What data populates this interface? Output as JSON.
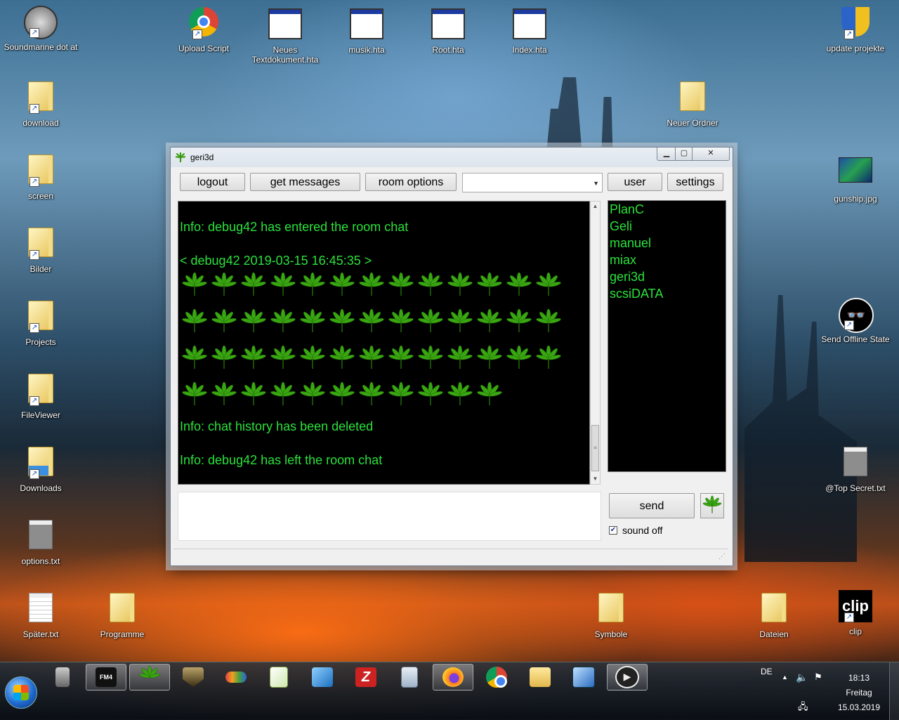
{
  "desktop": {
    "icons": [
      {
        "label": "Soundmarine dot at"
      },
      {
        "label": "Upload Script"
      },
      {
        "label": "Neues Textdokument.hta"
      },
      {
        "label": "musik.hta"
      },
      {
        "label": "Root.hta"
      },
      {
        "label": "Index.hta"
      },
      {
        "label": "update projekte"
      },
      {
        "label": "download"
      },
      {
        "label": "Neuer Ordner"
      },
      {
        "label": "screen"
      },
      {
        "label": "gunship.jpg"
      },
      {
        "label": "Bilder"
      },
      {
        "label": "Send Offline State"
      },
      {
        "label": "Projects"
      },
      {
        "label": "FileViewer"
      },
      {
        "label": "Downloads"
      },
      {
        "label": "@Top Secret.txt"
      },
      {
        "label": "options.txt"
      },
      {
        "label": "Später.txt"
      },
      {
        "label": "Programme"
      },
      {
        "label": "Symbole"
      },
      {
        "label": "Dateien"
      },
      {
        "label": "clip"
      }
    ],
    "clip_logo_text": "clip"
  },
  "window": {
    "title": "geri3d",
    "toolbar": {
      "logout": "logout",
      "get_messages": "get messages",
      "room_options": "room options",
      "room_select_value": "",
      "user": "user",
      "settings": "settings"
    },
    "chat": {
      "info_entered": "Info: debug42 has entered the room chat",
      "message_header": "< debug42 2019-03-15 16:45:35 >",
      "leaf_rows": [
        13,
        13,
        13,
        11
      ],
      "info_deleted": "Info: chat history has been deleted",
      "info_left": "Info: debug42 has left the room chat"
    },
    "users": [
      "PlanC",
      "Geli",
      "manuel",
      "miax",
      "geri3d",
      "scsiDATA"
    ],
    "send": "send",
    "sound_off_checked": true,
    "sound_off_label": "sound off",
    "colors": {
      "chat_text": "#2be13b",
      "chat_bg": "#000000"
    }
  },
  "taskbar": {
    "apps": [
      "speaker-app",
      "fm4-app",
      "geri3d-app",
      "game-app",
      "infinity-app",
      "notepad-plus-app",
      "network-app",
      "filezilla-app",
      "calculator-app",
      "firefox-app",
      "chrome-app",
      "file-explorer-app",
      "remote-desktop-app",
      "media-player-app"
    ],
    "active_app": "geri3d-app",
    "fm4_label": "FM4",
    "lang": "DE",
    "time": "18:13",
    "day": "Freitag",
    "date": "15.03.2019"
  }
}
